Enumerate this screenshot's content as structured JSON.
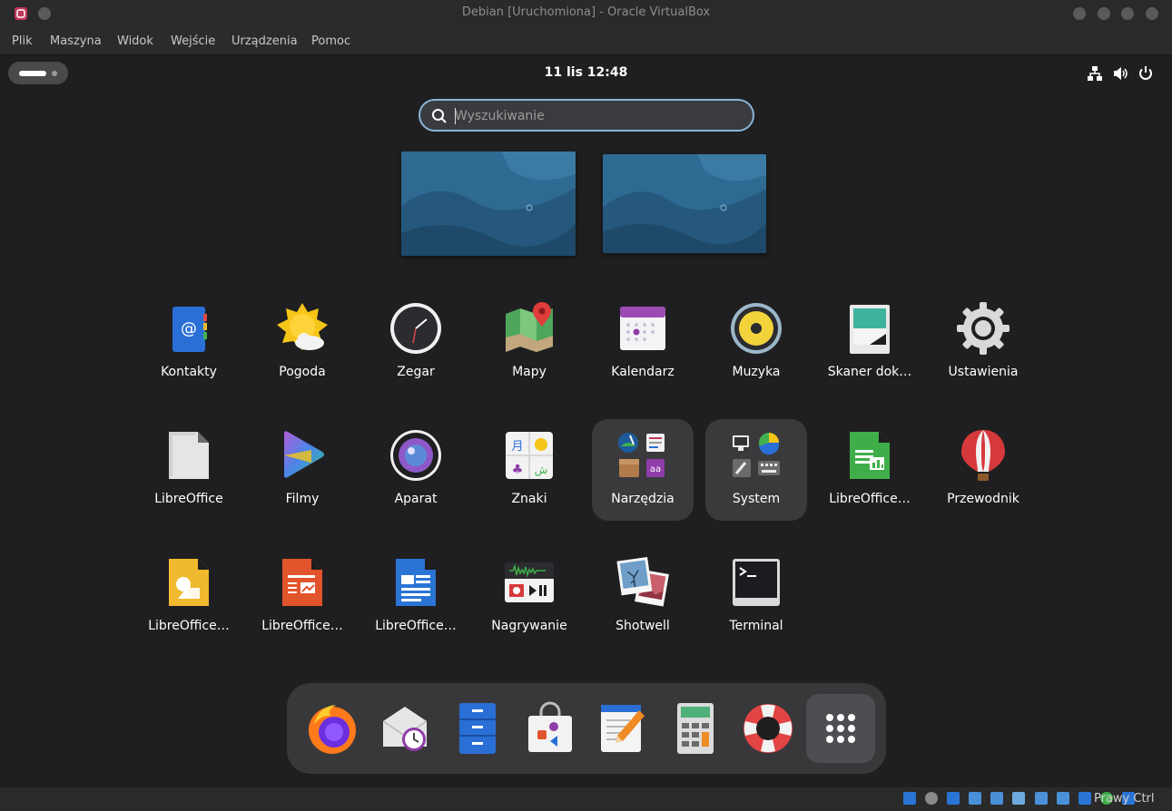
{
  "window": {
    "title": "Debian [Uruchomiona] - Oracle VirtualBox"
  },
  "menu": [
    "Plik",
    "Maszyna",
    "Widok",
    "Wejście",
    "Urządzenia",
    "Pomoc"
  ],
  "topbar": {
    "clock": "11 lis  12:48"
  },
  "search": {
    "placeholder": "Wyszukiwanie",
    "value": ""
  },
  "apps": [
    {
      "label": "Kontakty",
      "icon": "contacts-icon"
    },
    {
      "label": "Pogoda",
      "icon": "weather-icon"
    },
    {
      "label": "Zegar",
      "icon": "clock-icon"
    },
    {
      "label": "Mapy",
      "icon": "maps-icon"
    },
    {
      "label": "Kalendarz",
      "icon": "calendar-icon"
    },
    {
      "label": "Muzyka",
      "icon": "music-icon"
    },
    {
      "label": "Skaner dok…",
      "icon": "scanner-icon"
    },
    {
      "label": "Ustawienia",
      "icon": "settings-icon"
    },
    {
      "label": "LibreOffice",
      "icon": "libreoffice-icon"
    },
    {
      "label": "Filmy",
      "icon": "videos-icon"
    },
    {
      "label": "Aparat",
      "icon": "camera-icon"
    },
    {
      "label": "Znaki",
      "icon": "characters-icon"
    },
    {
      "label": "Narzędzia",
      "icon": "utilities-folder-icon"
    },
    {
      "label": "System",
      "icon": "system-folder-icon"
    },
    {
      "label": "LibreOffice…",
      "icon": "libreoffice-calc-icon"
    },
    {
      "label": "Przewodnik",
      "icon": "help-balloon-icon"
    },
    {
      "label": "LibreOffice…",
      "icon": "libreoffice-draw-icon"
    },
    {
      "label": "LibreOffice…",
      "icon": "libreoffice-impress-icon"
    },
    {
      "label": "LibreOffice…",
      "icon": "libreoffice-writer-icon"
    },
    {
      "label": "Nagrywanie",
      "icon": "sound-recorder-icon"
    },
    {
      "label": "Shotwell",
      "icon": "shotwell-icon"
    },
    {
      "label": "Terminal",
      "icon": "terminal-icon"
    }
  ],
  "dock": [
    "firefox-icon",
    "evolution-mail-icon",
    "files-icon",
    "software-center-icon",
    "text-editor-icon",
    "calculator-icon",
    "help-icon",
    "show-apps-icon"
  ],
  "statusbar": {
    "host_key": "Prawy Ctrl"
  }
}
